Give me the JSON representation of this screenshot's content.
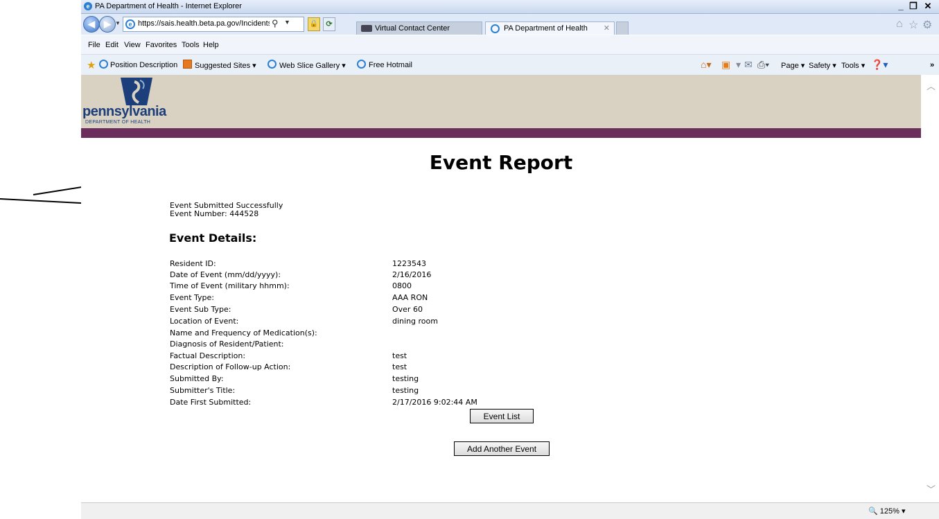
{
  "browser": {
    "window_title": "PA Department of Health - Internet Explorer",
    "url": "https://sais.health.beta.pa.gov/Incidents/form_",
    "tabs": [
      {
        "label": "Virtual Contact Center"
      },
      {
        "label": "PA Department of Health"
      }
    ],
    "menu": [
      "File",
      "Edit",
      "View",
      "Favorites",
      "Tools",
      "Help"
    ],
    "favorites": [
      {
        "label": "Position Description"
      },
      {
        "label": "Suggested Sites ▾"
      },
      {
        "label": "Web Slice Gallery ▾"
      },
      {
        "label": "Free Hotmail"
      }
    ],
    "command_bar": {
      "page": "Page ▾",
      "safety": "Safety ▾",
      "tools": "Tools ▾"
    },
    "zoom": "125%"
  },
  "logo": {
    "name": "pennsylvania",
    "subtitle": "DEPARTMENT OF HEALTH"
  },
  "page": {
    "heading": "Event Report",
    "status_line1": "Event Submitted Successfully",
    "status_line2": "Event Number: 444528",
    "details_heading": "Event Details:",
    "details": [
      {
        "label": "Resident ID:",
        "value": "1223543"
      },
      {
        "label": "Date of Event (mm/dd/yyyy):",
        "value": "2/16/2016"
      },
      {
        "label": "Time of Event (military hhmm):",
        "value": "0800"
      },
      {
        "label": "Event Type:",
        "value": "AAA RON"
      },
      {
        "label": "Event Sub Type:",
        "value": "Over 60"
      },
      {
        "label": "Location of Event:",
        "value": "dining room"
      },
      {
        "label": "Name and Frequency of Medication(s):",
        "value": ""
      },
      {
        "label": "Diagnosis of Resident/Patient:",
        "value": ""
      },
      {
        "label": "Factual Description:",
        "value": "test"
      },
      {
        "label": "Description of Follow-up Action:",
        "value": "test"
      },
      {
        "label": "Submitted By:",
        "value": "testing"
      },
      {
        "label": "Submitter's Title:",
        "value": "testing"
      },
      {
        "label": "Date First Submitted:",
        "value": "2/17/2016 9:02:44 AM"
      }
    ],
    "buttons": {
      "event_list": "Event List",
      "add_another": "Add Another Event"
    }
  },
  "colors": {
    "header_bg": "#d9d2c3",
    "header_stripe": "#6b2d5c",
    "logo_blue": "#1c3e7a"
  },
  "icons": [
    "back-icon",
    "forward-icon",
    "search-icon",
    "lock-icon",
    "refresh-icon",
    "home-icon",
    "star-icon",
    "gear-icon",
    "help-icon",
    "print-icon",
    "rss-icon",
    "mail-icon",
    "zoom-icon"
  ]
}
